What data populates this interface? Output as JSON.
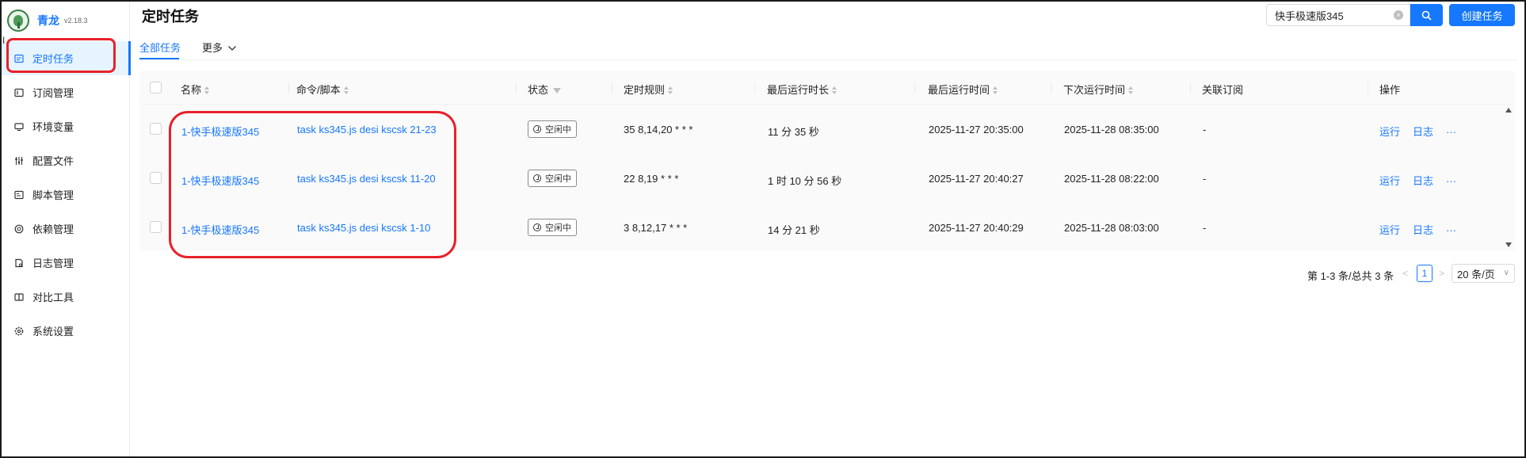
{
  "app": {
    "title": "青龙",
    "version": "v2.18.3"
  },
  "sidebar": {
    "items": [
      {
        "label": "定时任务",
        "icon": "calendar-icon",
        "active": true
      },
      {
        "label": "订阅管理",
        "icon": "subscription-icon"
      },
      {
        "label": "环境变量",
        "icon": "monitor-icon"
      },
      {
        "label": "配置文件",
        "icon": "sliders-icon"
      },
      {
        "label": "脚本管理",
        "icon": "code-file-icon"
      },
      {
        "label": "依赖管理",
        "icon": "package-icon"
      },
      {
        "label": "日志管理",
        "icon": "log-file-icon"
      },
      {
        "label": "对比工具",
        "icon": "diff-icon"
      },
      {
        "label": "系统设置",
        "icon": "gear-icon"
      }
    ]
  },
  "header": {
    "title": "定时任务",
    "search_value": "快手极速版345",
    "create_label": "创建任务"
  },
  "tabs": {
    "all": "全部任务",
    "more": "更多"
  },
  "table": {
    "columns": {
      "name": "名称",
      "command": "命令/脚本",
      "status": "状态",
      "schedule": "定时规则",
      "last_duration": "最后运行时长",
      "last_run": "最后运行时间",
      "next_run": "下次运行时间",
      "subscription": "关联订阅",
      "actions": "操作"
    },
    "rows": [
      {
        "name": "1-快手极速版345",
        "command": "task ks345.js desi kscsk 21-23",
        "status": "空闲中",
        "schedule": "35 8,14,20 * * *",
        "last_duration": "11 分 35 秒",
        "last_run": "2025-11-27 20:35:00",
        "next_run": "2025-11-28 08:35:00",
        "subscription": "-",
        "run": "运行",
        "log": "日志",
        "more": "···"
      },
      {
        "name": "1-快手极速版345",
        "command": "task ks345.js desi kscsk 11-20",
        "status": "空闲中",
        "schedule": "22 8,19 * * *",
        "last_duration": "1 时 10 分 56 秒",
        "last_run": "2025-11-27 20:40:27",
        "next_run": "2025-11-28 08:22:00",
        "subscription": "-",
        "run": "运行",
        "log": "日志",
        "more": "···"
      },
      {
        "name": "1-快手极速版345",
        "command": "task ks345.js desi kscsk 1-10",
        "status": "空闲中",
        "schedule": "3 8,12,17 * * *",
        "last_duration": "14 分 21 秒",
        "last_run": "2025-11-27 20:40:29",
        "next_run": "2025-11-28 08:03:00",
        "subscription": "-",
        "run": "运行",
        "log": "日志",
        "more": "···"
      }
    ]
  },
  "pagination": {
    "summary": "第 1-3 条/总共 3 条",
    "current": "1",
    "page_size": "20 条/页"
  },
  "colors": {
    "accent": "#1677ff",
    "highlight": "#e8212a"
  }
}
